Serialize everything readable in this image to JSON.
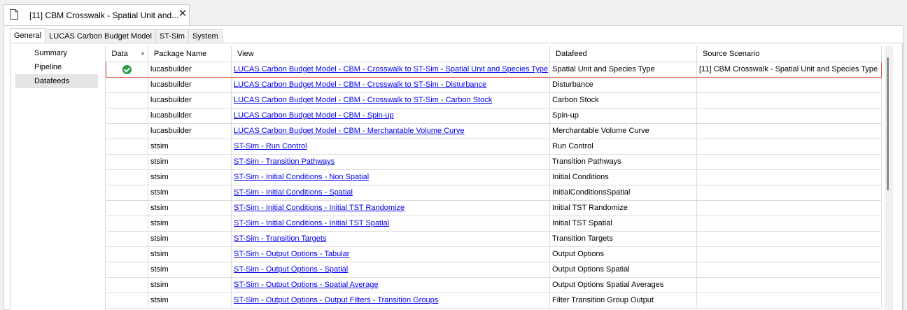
{
  "document_tab": {
    "title": "[11] CBM Crosswalk - Spatial Unit and...",
    "close_glyph": "✕"
  },
  "sub_tabs": [
    "General",
    "LUCAS Carbon Budget Model",
    "ST-Sim",
    "System"
  ],
  "side_nav": [
    "Summary",
    "Pipeline",
    "Datafeeds"
  ],
  "grid": {
    "columns": [
      "Data",
      "Package Name",
      "View",
      "Datafeed",
      "Source Scenario"
    ],
    "rows": [
      {
        "data": "check",
        "package": "lucasbuilder",
        "view": "LUCAS Carbon Budget Model - CBM - Crosswalk to ST-Sim - Spatial Unit and Species Type",
        "datafeed": "Spatial Unit and Species Type",
        "source": "[11] CBM Crosswalk - Spatial Unit and Species Type"
      },
      {
        "data": "",
        "package": "lucasbuilder",
        "view": "LUCAS Carbon Budget Model - CBM - Crosswalk to ST-Sim - Disturbance",
        "datafeed": "Disturbance",
        "source": ""
      },
      {
        "data": "",
        "package": "lucasbuilder",
        "view": "LUCAS Carbon Budget Model - CBM - Crosswalk to ST-Sim - Carbon Stock",
        "datafeed": "Carbon Stock",
        "source": ""
      },
      {
        "data": "",
        "package": "lucasbuilder",
        "view": "LUCAS Carbon Budget Model - CBM - Spin-up",
        "datafeed": "Spin-up",
        "source": ""
      },
      {
        "data": "",
        "package": "lucasbuilder",
        "view": "LUCAS Carbon Budget Model - CBM - Merchantable Volume Curve",
        "datafeed": "Merchantable Volume Curve",
        "source": ""
      },
      {
        "data": "",
        "package": "stsim",
        "view": "ST-Sim - Run Control",
        "datafeed": "Run Control",
        "source": ""
      },
      {
        "data": "",
        "package": "stsim",
        "view": "ST-Sim - Transition Pathways",
        "datafeed": "Transition Pathways",
        "source": ""
      },
      {
        "data": "",
        "package": "stsim",
        "view": "ST-Sim - Initial Conditions - Non Spatial",
        "datafeed": "Initial Conditions",
        "source": ""
      },
      {
        "data": "",
        "package": "stsim",
        "view": "ST-Sim - Initial Conditions - Spatial",
        "datafeed": "InitialConditionsSpatial",
        "source": ""
      },
      {
        "data": "",
        "package": "stsim",
        "view": "ST-Sim - Initial Conditions - Initial TST Randomize",
        "datafeed": "Initial TST Randomize",
        "source": ""
      },
      {
        "data": "",
        "package": "stsim",
        "view": "ST-Sim - Initial Conditions - Initial TST Spatial",
        "datafeed": "Initial TST Spatial",
        "source": ""
      },
      {
        "data": "",
        "package": "stsim",
        "view": "ST-Sim - Transition Targets",
        "datafeed": "Transition Targets",
        "source": ""
      },
      {
        "data": "",
        "package": "stsim",
        "view": "ST-Sim - Output Options - Tabular",
        "datafeed": "Output Options",
        "source": ""
      },
      {
        "data": "",
        "package": "stsim",
        "view": "ST-Sim - Output Options - Spatial",
        "datafeed": "Output Options Spatial",
        "source": ""
      },
      {
        "data": "",
        "package": "stsim",
        "view": "ST-Sim - Output Options - Spatial Average",
        "datafeed": "Output Options Spatial Averages",
        "source": ""
      },
      {
        "data": "",
        "package": "stsim",
        "view": "ST-Sim - Output Options - Output Filters - Transition Groups",
        "datafeed": "Filter Transition Group Output",
        "source": ""
      }
    ]
  },
  "colors": {
    "link": "#0000ee",
    "check": "#2e9b48",
    "selection_border": "#d9534f"
  }
}
